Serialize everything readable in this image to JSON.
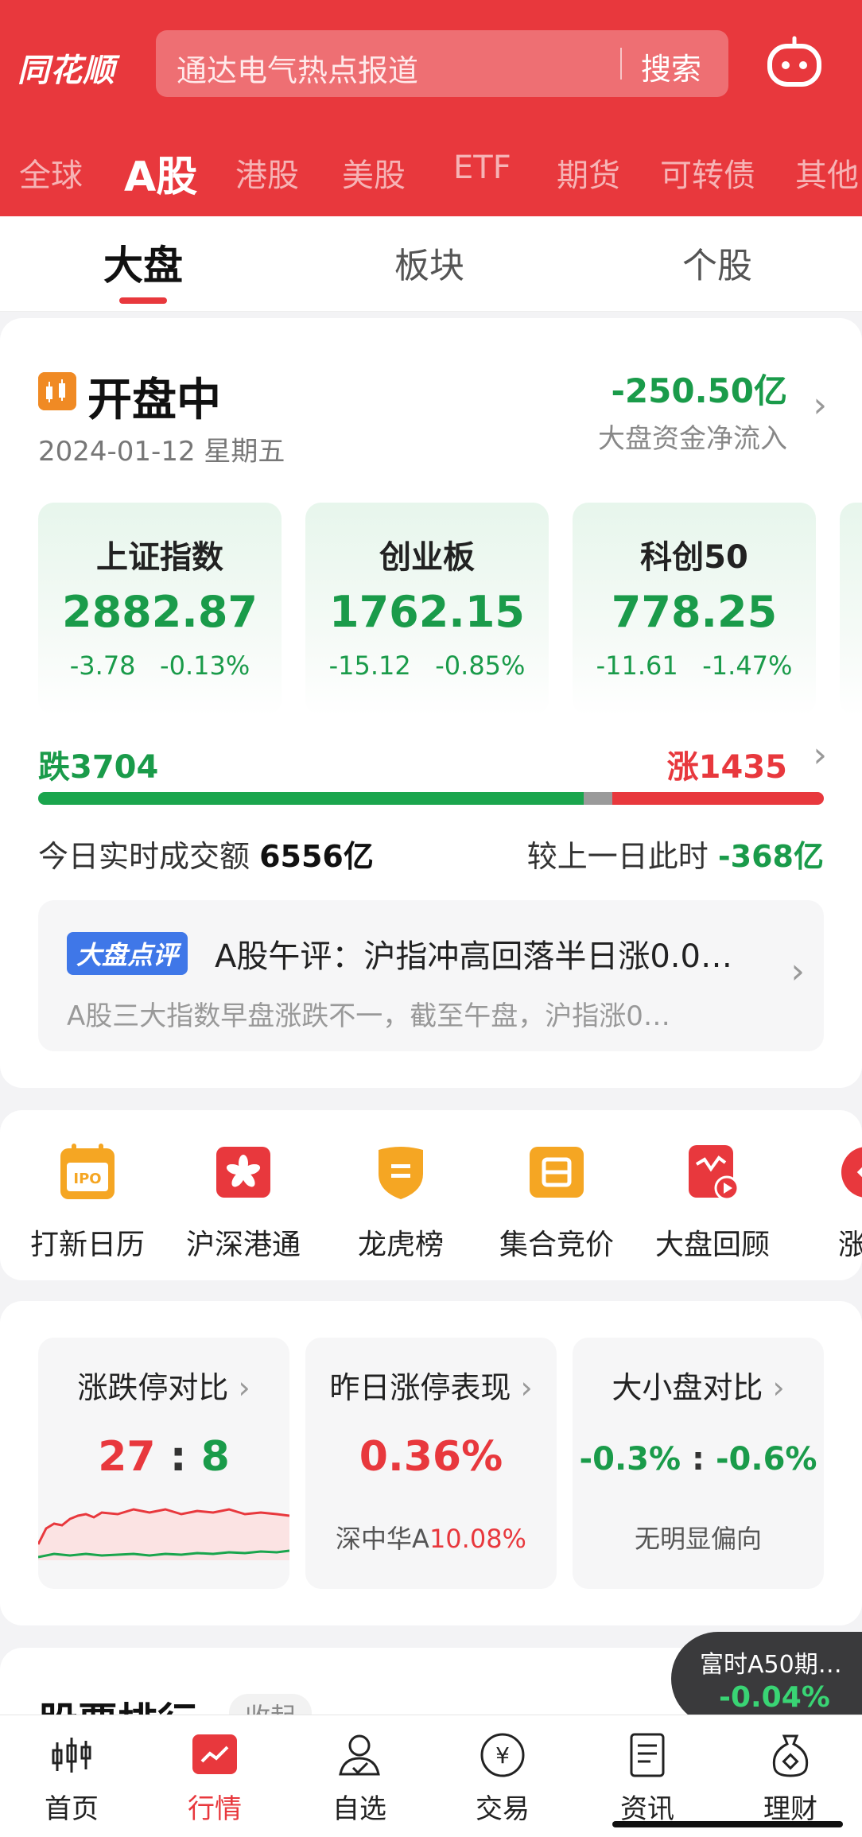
{
  "app": {
    "logo": "同花顺"
  },
  "search": {
    "placeholder": "通达电气热点报道",
    "button": "搜索"
  },
  "market_tabs": [
    "全球",
    "A股",
    "港股",
    "美股",
    "ETF",
    "期货",
    "可转债",
    "其他"
  ],
  "sub_tabs": [
    "大盘",
    "板块",
    "个股"
  ],
  "status": {
    "title": "开盘中",
    "date": "2024-01-12 星期五",
    "net_flow": "-250.50亿",
    "net_flow_label": "大盘资金净流入"
  },
  "indices": [
    {
      "name": "上证指数",
      "price": "2882.87",
      "change": "-3.78",
      "pct": "-0.13%"
    },
    {
      "name": "创业板",
      "price": "1762.15",
      "change": "-15.12",
      "pct": "-0.85%"
    },
    {
      "name": "科创50",
      "price": "778.25",
      "change": "-11.61",
      "pct": "-1.47%"
    }
  ],
  "breadth": {
    "fall_label": "跌3704",
    "rise_label": "涨1435",
    "fall": 3704,
    "rise": 1435
  },
  "turnover": {
    "label": "今日实时成交额",
    "value": "6556亿",
    "compare_label": "较上一日此时",
    "compare_value": "-368亿"
  },
  "comment": {
    "badge": "大盘点评",
    "title": "A股午评：沪指冲高回落半日涨0.0…",
    "summary": "A股三大指数早盘涨跌不一，截至午盘，沪指涨0…"
  },
  "tools": [
    {
      "label": "打新日历",
      "icon": "ipo-calendar-icon",
      "color": "#f5a623"
    },
    {
      "label": "沪深港通",
      "icon": "hk-flag-icon",
      "color": "#e8383d"
    },
    {
      "label": "龙虎榜",
      "icon": "shield-icon",
      "color": "#f5a623"
    },
    {
      "label": "集合竞价",
      "icon": "bid-icon",
      "color": "#f5a623"
    },
    {
      "label": "大盘回顾",
      "icon": "replay-icon",
      "color": "#e8383d"
    },
    {
      "label": "涨停",
      "icon": "limit-up-icon",
      "color": "#e8383d"
    }
  ],
  "compare_cards": [
    {
      "title": "涨跌停对比",
      "left": "27",
      "sep": ":",
      "right": "8"
    },
    {
      "title": "昨日涨停表现",
      "value": "0.36%",
      "sub_name": "深中华A",
      "sub_value": "10.08%"
    },
    {
      "title": "大小盘对比",
      "left": "-0.3%",
      "sep": ":",
      "right": "-0.6%",
      "sub": "无明显偏向"
    }
  ],
  "ranking": {
    "title": "股票排行",
    "toggle": "收起"
  },
  "a50": {
    "name": "富时A50期…",
    "value": "-0.04%"
  },
  "bottom_nav": [
    "首页",
    "行情",
    "自选",
    "交易",
    "资讯",
    "理财"
  ],
  "colors": {
    "brand_red": "#e8383d",
    "down_green": "#1a9b4a",
    "flat_gray": "#9a9a9a"
  }
}
